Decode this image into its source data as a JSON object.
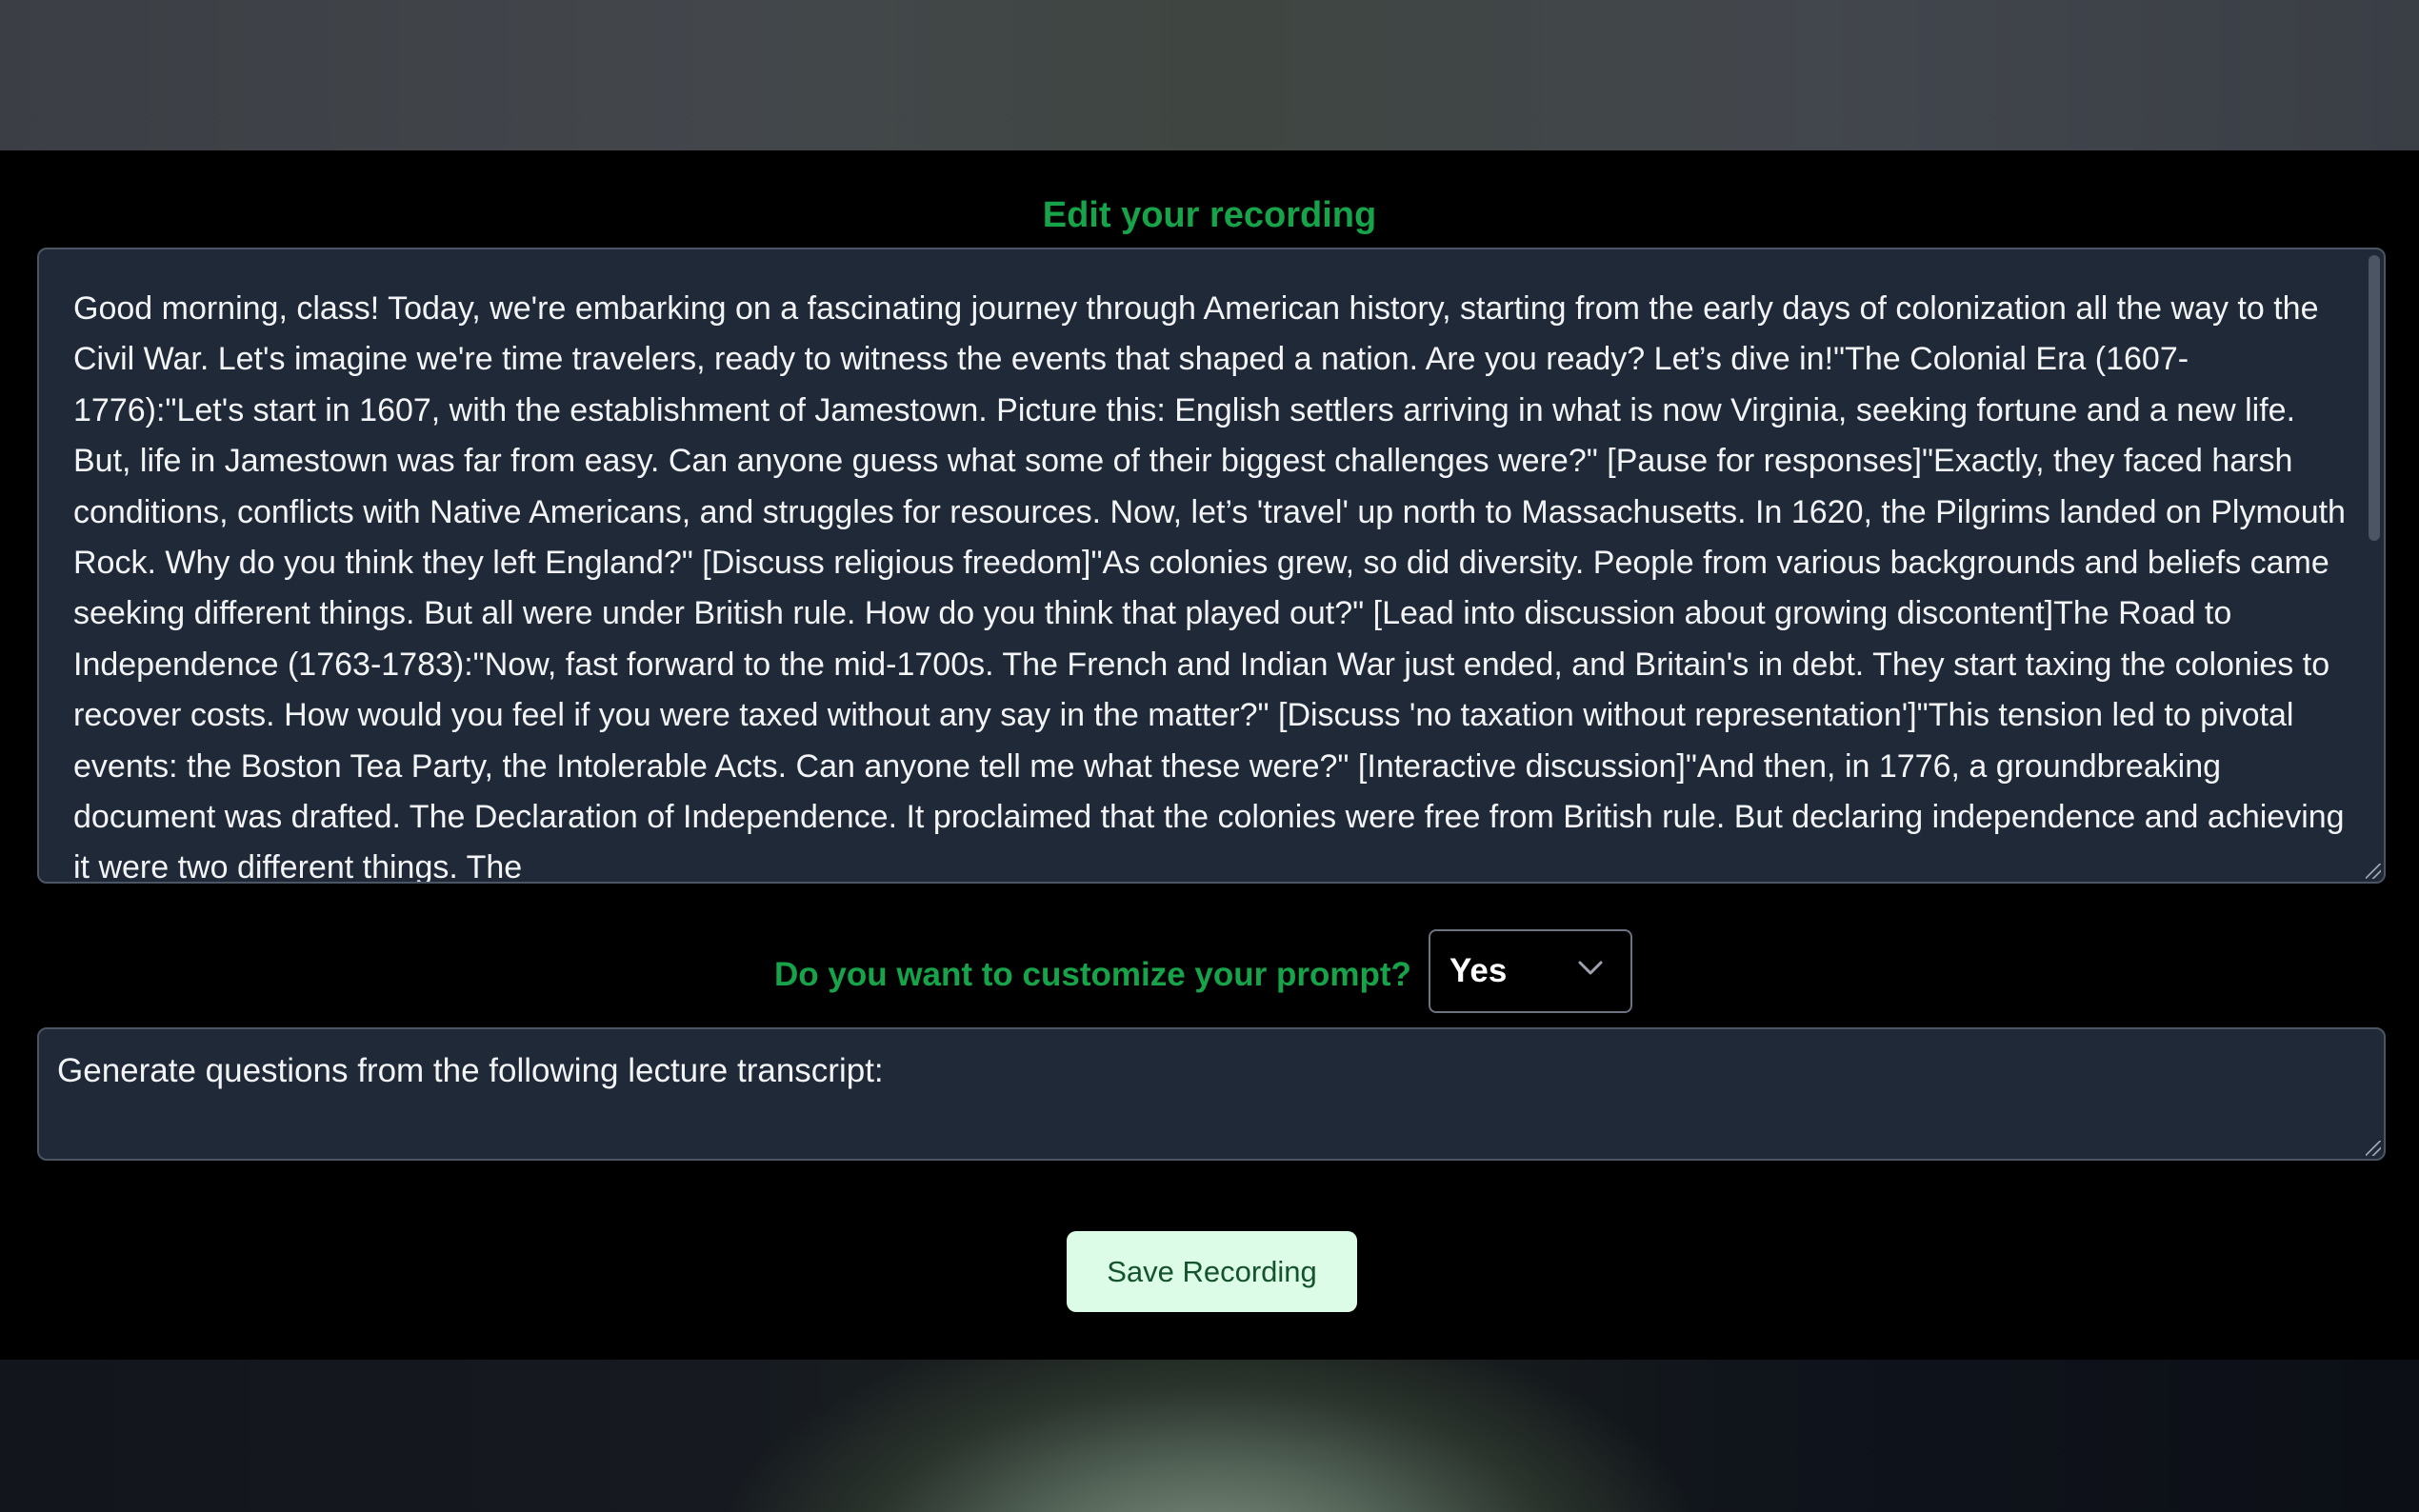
{
  "editor": {
    "heading": "Edit your recording",
    "transcript": "Good morning, class! Today, we're embarking on a fascinating journey through American history, starting from the early days of colonization all the way to the Civil War. Let's imagine we're time travelers, ready to witness the events that shaped a nation. Are you ready? Let’s dive in!\"The Colonial Era (1607-1776):\"Let's start in 1607, with the establishment of Jamestown. Picture this: English settlers arriving in what is now Virginia, seeking fortune and a new life. But, life in Jamestown was far from easy. Can anyone guess what some of their biggest challenges were?\" [Pause for responses]\"Exactly, they faced harsh conditions, conflicts with Native Americans, and struggles for resources. Now, let’s 'travel' up north to Massachusetts. In 1620, the Pilgrims landed on Plymouth Rock. Why do you think they left England?\" [Discuss religious freedom]\"As colonies grew, so did diversity. People from various backgrounds and beliefs came seeking different things. But all were under British rule. How do you think that played out?\" [Lead into discussion about growing discontent]The Road to Independence (1763-1783):\"Now, fast forward to the mid-1700s. The French and Indian War just ended, and Britain's in debt. They start taxing the colonies to recover costs. How would you feel if you were taxed without any say in the matter?\" [Discuss 'no taxation without representation']\"This tension led to pivotal events: the Boston Tea Party, the Intolerable Acts. Can anyone tell me what these were?\" [Interactive discussion]\"And then, in 1776, a groundbreaking document was drafted. The Declaration of Independence. It proclaimed that the colonies were free from British rule. But declaring independence and achieving it were two different things. The"
  },
  "customize": {
    "question": "Do you want to customize your prompt?",
    "selected": "Yes",
    "icon": "chevron-down-icon"
  },
  "prompt": {
    "value": "Generate questions from the following lecture transcript:"
  },
  "actions": {
    "save_label": "Save Recording"
  },
  "colors": {
    "accent_green": "#16a34a",
    "field_background": "#1f2937",
    "button_background": "#dcfce7"
  }
}
